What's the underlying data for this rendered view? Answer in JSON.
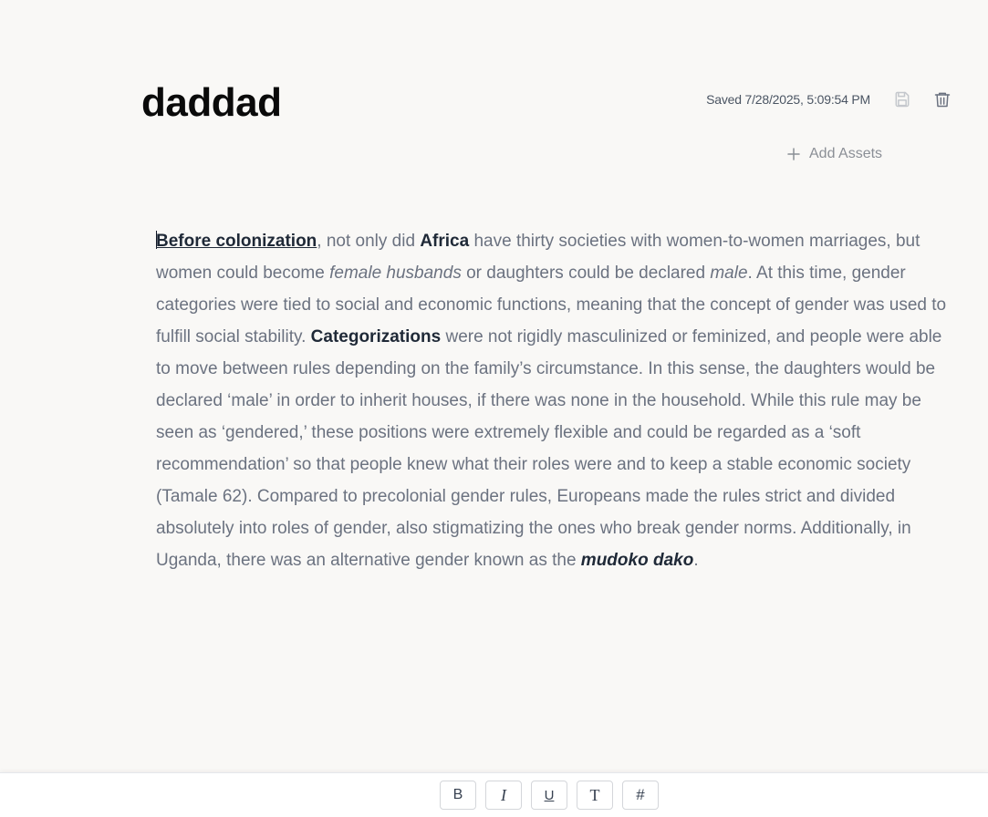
{
  "document": {
    "title": "daddad",
    "saved_status": "Saved 7/28/2025, 5:09:54 PM",
    "add_assets_label": "Add Assets"
  },
  "icons": {
    "save": "save-icon",
    "delete": "trash-icon",
    "add": "plus-icon"
  },
  "body": {
    "s1_link": "Before colonization",
    "s2": ", not only did ",
    "s3_bold": "Africa",
    "s4": " have thirty societies with women-to-women marriages, but women could become ",
    "s5_italic": "female husbands",
    "s6": " or daughters could be declared ",
    "s7_italic": "male",
    "s8": ". At this time, gender categories were tied to social and economic functions, meaning that the concept of gender was used to fulfill social stability. ",
    "s9_bold": "Categorizations",
    "s10": " were not rigidly masculinized or feminized, and people were able to move between rules depending on the family’s circumstance. In this sense, the daughters would be declared ‘male’ in order to inherit houses, if there was none in the household. While this rule may be seen as ‘gendered,’ these positions were extremely flexible and could be regarded as a ‘soft recommendation’ so that people knew what their roles were and to keep a stable economic society (Tamale 62). Compared to precolonial gender rules, Europeans made the rules strict and divided absolutely into roles of gender, also stigmatizing the ones who break gender norms. Additionally, in Uganda, there was an alternative gender known as the ",
    "s11_bold_italic": "mudoko dako",
    "s12": "."
  },
  "toolbar": {
    "bold_label": "B",
    "italic_label": "I",
    "underline_label": "U",
    "text_label": "T",
    "heading_label": "#"
  },
  "colors": {
    "background": "#f9f8f6",
    "body_text": "#6b7280",
    "emphasis_text": "#1f2937",
    "title": "#0a0a0a"
  }
}
